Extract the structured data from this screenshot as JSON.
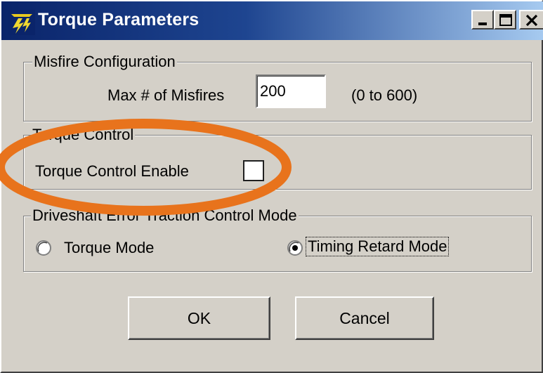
{
  "window": {
    "title": "Torque Parameters",
    "app_icon": "flash-logo-icon",
    "controls": [
      "minimize-icon",
      "maximize-icon",
      "close-icon"
    ]
  },
  "misfire": {
    "legend": "Misfire Configuration",
    "label": "Max # of Misfires",
    "value": "200",
    "range": "(0 to 600)"
  },
  "torque_control": {
    "legend": "Torque Control",
    "label": "Torque Control Enable",
    "checked": false
  },
  "traction": {
    "legend": "Driveshaft Error Traction Control Mode",
    "options": [
      {
        "label": "Torque Mode",
        "selected": false
      },
      {
        "label": "Timing Retard Mode",
        "selected": true
      }
    ]
  },
  "buttons": {
    "ok": "OK",
    "cancel": "Cancel"
  },
  "colors": {
    "dialog_bg": "#d4d0c8",
    "title_start": "#0a246a",
    "title_end": "#a6caf0",
    "annotation": "#e8731c"
  }
}
